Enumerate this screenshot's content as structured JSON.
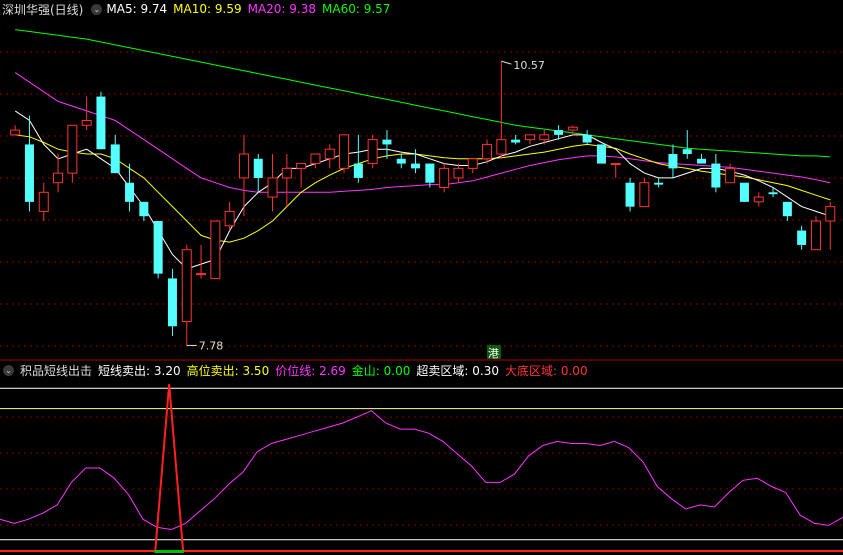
{
  "main_header": {
    "title": "深圳华强(日线)",
    "ma": [
      {
        "label": "MA5:",
        "value": "9.74",
        "color": "#ffffff"
      },
      {
        "label": "MA10:",
        "value": "9.59",
        "color": "#ffff00"
      },
      {
        "label": "MA20:",
        "value": "9.38",
        "color": "#ff33ff"
      },
      {
        "label": "MA60:",
        "value": "9.57",
        "color": "#00ff00"
      }
    ]
  },
  "price_annotations": {
    "high": "10.57",
    "low": "7.78"
  },
  "marker_label": "港",
  "indicator_header": {
    "title": "积品短线出击",
    "items": [
      {
        "label": "短线卖出:",
        "value": "3.20",
        "color": "#ffffff"
      },
      {
        "label": "高位卖出:",
        "value": "3.50",
        "color": "#ffff00"
      },
      {
        "label": "价位线:",
        "value": "2.69",
        "color": "#ff33ff"
      },
      {
        "label": "金山:",
        "value": "0.00",
        "color": "#00ff00"
      },
      {
        "label": "超卖区域:",
        "value": "0.30",
        "color": "#ffffff"
      },
      {
        "label": "大底区域:",
        "value": "0.00",
        "color": "#ff3333"
      }
    ]
  },
  "colors": {
    "up": "#ff3232",
    "down": "#54ffff",
    "ma5": "#ffffff",
    "ma10": "#ffff00",
    "ma20": "#ff33ff",
    "ma60": "#00ff00",
    "grid": "#8b0000",
    "divider": "#b00000"
  },
  "chart_data": {
    "type": "candlestick",
    "price_axis": {
      "min": 7.5,
      "max": 11.0
    },
    "candles": [
      [
        9.8,
        9.9,
        9.8,
        9.85
      ],
      [
        9.7,
        10.0,
        9.0,
        9.1
      ],
      [
        9.0,
        9.3,
        8.9,
        9.2
      ],
      [
        9.3,
        9.6,
        9.2,
        9.4
      ],
      [
        9.4,
        9.9,
        9.3,
        9.9
      ],
      [
        9.9,
        10.2,
        9.85,
        9.95
      ],
      [
        10.2,
        10.25,
        9.65,
        9.65
      ],
      [
        9.7,
        9.8,
        9.4,
        9.4
      ],
      [
        9.3,
        9.5,
        9.0,
        9.1
      ],
      [
        9.1,
        9.1,
        8.9,
        8.95
      ],
      [
        8.9,
        8.9,
        8.3,
        8.35
      ],
      [
        8.3,
        8.4,
        7.7,
        7.8
      ],
      [
        7.85,
        8.65,
        7.6,
        8.6
      ],
      [
        8.35,
        8.65,
        8.3,
        8.35
      ],
      [
        8.3,
        8.9,
        8.3,
        8.9
      ],
      [
        8.85,
        9.1,
        8.8,
        9.0
      ],
      [
        9.35,
        9.8,
        8.95,
        9.6
      ],
      [
        9.55,
        9.6,
        9.2,
        9.35
      ],
      [
        9.15,
        9.6,
        9.0,
        9.35
      ],
      [
        9.35,
        9.6,
        9.05,
        9.45
      ],
      [
        9.45,
        9.5,
        9.25,
        9.5
      ],
      [
        9.5,
        9.6,
        9.45,
        9.6
      ],
      [
        9.55,
        9.7,
        9.45,
        9.65
      ],
      [
        9.45,
        9.8,
        9.4,
        9.8
      ],
      [
        9.5,
        9.8,
        9.3,
        9.35
      ],
      [
        9.5,
        9.8,
        9.45,
        9.75
      ],
      [
        9.75,
        9.85,
        9.55,
        9.7
      ],
      [
        9.55,
        9.6,
        9.45,
        9.5
      ],
      [
        9.5,
        9.65,
        9.4,
        9.45
      ],
      [
        9.5,
        9.5,
        9.25,
        9.3
      ],
      [
        9.25,
        9.5,
        9.2,
        9.45
      ],
      [
        9.35,
        9.5,
        9.3,
        9.45
      ],
      [
        9.45,
        9.55,
        9.4,
        9.55
      ],
      [
        9.55,
        9.75,
        9.5,
        9.7
      ],
      [
        9.6,
        10.57,
        9.55,
        9.75
      ],
      [
        9.75,
        9.8,
        9.7,
        9.72
      ],
      [
        9.75,
        9.8,
        9.7,
        9.8
      ],
      [
        9.75,
        9.85,
        9.7,
        9.8
      ],
      [
        9.85,
        9.9,
        9.75,
        9.8
      ],
      [
        9.85,
        9.9,
        9.8,
        9.88
      ],
      [
        9.8,
        9.85,
        9.7,
        9.72
      ],
      [
        9.7,
        9.7,
        9.5,
        9.5
      ],
      [
        9.5,
        9.5,
        9.35,
        9.5
      ],
      [
        9.3,
        9.35,
        9.0,
        9.05
      ],
      [
        9.05,
        9.35,
        9.05,
        9.3
      ],
      [
        9.3,
        9.35,
        9.25,
        9.28
      ],
      [
        9.6,
        9.7,
        9.35,
        9.45
      ],
      [
        9.65,
        9.85,
        9.55,
        9.6
      ],
      [
        9.55,
        9.6,
        9.5,
        9.5
      ],
      [
        9.5,
        9.6,
        9.2,
        9.25
      ],
      [
        9.3,
        9.5,
        9.3,
        9.45
      ],
      [
        9.3,
        9.3,
        9.1,
        9.1
      ],
      [
        9.1,
        9.2,
        9.05,
        9.15
      ],
      [
        9.2,
        9.25,
        9.15,
        9.18
      ],
      [
        9.1,
        9.1,
        8.9,
        8.95
      ],
      [
        8.8,
        8.85,
        8.6,
        8.65
      ],
      [
        8.6,
        8.95,
        8.6,
        8.9
      ],
      [
        8.9,
        9.1,
        8.6,
        9.05
      ]
    ],
    "ma5": [
      10.05,
      9.95,
      9.7,
      9.55,
      9.6,
      9.65,
      9.55,
      9.45,
      9.25,
      9.05,
      8.8,
      8.55,
      8.4,
      8.45,
      8.5,
      8.8,
      9.05,
      9.2,
      9.3,
      9.45,
      9.45,
      9.5,
      9.55,
      9.6,
      9.62,
      9.65,
      9.65,
      9.62,
      9.6,
      9.55,
      9.5,
      9.48,
      9.48,
      9.52,
      9.58,
      9.62,
      9.68,
      9.72,
      9.76,
      9.8,
      9.8,
      9.72,
      9.65,
      9.5,
      9.4,
      9.35,
      9.35,
      9.4,
      9.45,
      9.45,
      9.42,
      9.38,
      9.32,
      9.25,
      9.15,
      9.05,
      9.0,
      8.95
    ],
    "ma10": [
      9.8,
      9.78,
      9.72,
      9.65,
      9.62,
      9.6,
      9.6,
      9.55,
      9.45,
      9.35,
      9.2,
      9.05,
      8.9,
      8.75,
      8.7,
      8.68,
      8.72,
      8.8,
      8.9,
      9.05,
      9.2,
      9.3,
      9.38,
      9.45,
      9.5,
      9.55,
      9.58,
      9.6,
      9.6,
      9.58,
      9.56,
      9.55,
      9.55,
      9.55,
      9.56,
      9.58,
      9.6,
      9.62,
      9.65,
      9.68,
      9.7,
      9.68,
      9.66,
      9.6,
      9.55,
      9.5,
      9.47,
      9.45,
      9.42,
      9.4,
      9.38,
      9.36,
      9.33,
      9.3,
      9.27,
      9.22,
      9.17,
      9.12
    ],
    "ma20": [
      10.45,
      10.35,
      10.25,
      10.15,
      10.1,
      10.05,
      10.0,
      9.95,
      9.85,
      9.75,
      9.65,
      9.55,
      9.45,
      9.35,
      9.3,
      9.25,
      9.22,
      9.2,
      9.2,
      9.2,
      9.2,
      9.2,
      9.2,
      9.21,
      9.22,
      9.23,
      9.25,
      9.26,
      9.27,
      9.28,
      9.28,
      9.3,
      9.32,
      9.36,
      9.4,
      9.44,
      9.48,
      9.51,
      9.54,
      9.56,
      9.58,
      9.58,
      9.57,
      9.55,
      9.53,
      9.51,
      9.5,
      9.49,
      9.48,
      9.47,
      9.46,
      9.44,
      9.42,
      9.4,
      9.38,
      9.36,
      9.33,
      9.3
    ],
    "ma60": [
      10.9,
      10.88,
      10.86,
      10.84,
      10.82,
      10.8,
      10.77,
      10.74,
      10.71,
      10.68,
      10.65,
      10.62,
      10.59,
      10.56,
      10.53,
      10.5,
      10.47,
      10.44,
      10.41,
      10.38,
      10.35,
      10.32,
      10.29,
      10.26,
      10.23,
      10.2,
      10.17,
      10.14,
      10.11,
      10.08,
      10.05,
      10.02,
      9.99,
      9.96,
      9.93,
      9.9,
      9.88,
      9.86,
      9.84,
      9.82,
      9.8,
      9.78,
      9.76,
      9.74,
      9.72,
      9.7,
      9.68,
      9.66,
      9.65,
      9.64,
      9.63,
      9.62,
      9.61,
      9.6,
      9.59,
      9.58,
      9.58,
      9.57
    ],
    "indicator": {
      "axis": {
        "min": 0,
        "max": 4.2
      },
      "top_line": 4.0,
      "upper_line": 3.5,
      "lower_line": 0.3,
      "base_line": 0.0,
      "price_line": [
        0.8,
        0.7,
        0.8,
        0.95,
        1.15,
        1.7,
        2.05,
        2.05,
        1.8,
        1.4,
        0.8,
        0.6,
        0.55,
        0.7,
        1.0,
        1.3,
        1.65,
        1.95,
        2.45,
        2.65,
        2.75,
        2.85,
        2.95,
        3.05,
        3.15,
        3.3,
        3.45,
        3.15,
        3.0,
        3.0,
        2.9,
        2.7,
        2.4,
        2.1,
        1.7,
        1.7,
        1.9,
        2.35,
        2.6,
        2.7,
        2.65,
        2.65,
        2.6,
        2.7,
        2.55,
        2.2,
        1.6,
        1.3,
        1.05,
        1.15,
        1.1,
        1.45,
        1.75,
        1.8,
        1.6,
        1.45,
        0.9,
        0.7,
        0.65,
        0.85
      ],
      "spike_index": 11,
      "spike_value": 4.1
    }
  }
}
